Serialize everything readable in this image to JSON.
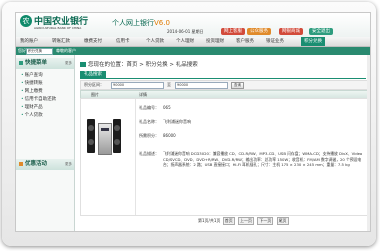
{
  "header": {
    "logo_glyph": "农",
    "bank_name": "中国农业银行",
    "bank_name_en": "AGRICULTURAL BANK OF CHINA",
    "product_name": "个人网上银行",
    "product_version": "V6.0",
    "date": "2014-06-01 星期日",
    "buttons": [
      {
        "label": "网上客服",
        "color": "#d24a3a"
      },
      {
        "label": "公众服务",
        "color": "#e08a2a"
      },
      {
        "label": "网银商城",
        "color": "#d24a3a"
      },
      {
        "label": "安全退出",
        "color": "#2d9c7e"
      }
    ]
  },
  "nav": {
    "items": [
      "我的账户",
      "转账汇款",
      "缴费支付",
      "信用卡",
      "个人贷款",
      "个人理财",
      "投资理财",
      "客户服务",
      "银证业务",
      "积分兑换"
    ],
    "active": "积分兑换"
  },
  "userbar": {
    "prefix": "您好",
    "account_select": "积分兑换",
    "suffix": "尊敬的客户"
  },
  "sidebar": {
    "quick_title": "快捷菜单",
    "quick_more": "更多",
    "quick_items": [
      "账户查询",
      "快捷转账",
      "网上缴费",
      "信用卡自助还款",
      "理财产品",
      "个人贷款"
    ],
    "promo_title": "优惠活动",
    "promo_more": "更多"
  },
  "main": {
    "breadcrumb": "您现在的位置：首页 > 积分兑换 > 礼品搜索",
    "tab_label": "礼品搜索",
    "filter": {
      "label": "积分区间：",
      "from_value": "90000",
      "to_label": "至",
      "to_value": "90000",
      "button": "查询"
    },
    "table_headers": [
      "图片",
      "详情"
    ],
    "product": {
      "rows": [
        {
          "label": "礼品编号：",
          "value": "065"
        },
        {
          "label": "礼品名称：",
          "value": "飞利浦迷你音响"
        },
        {
          "label": "所需积分：",
          "value": "86000"
        }
      ],
      "desc_label": "礼品描述：",
      "description": "飞利浦迷你音响 DCD3020：兼容播放 CD、CD-R/RW、MP3-CD、USB 闪存盘；WMA-CD；支持播放 DivX、Video CD/SVCD、DVD、DVD+R/RW、DVD-R/RW；输出功率：总功率 150W；收音机：FM/AM 数字调谐，20 个预设电台；扬声器系统：2 路；USB 直接接口；Hi-Fi 耳机插孔；尺寸：主机 175 × 230 × 245 mm；重量：7.5 kg"
    },
    "pager": {
      "text": "第1页/共1页",
      "buttons": [
        "首页",
        "上一页",
        "下一页",
        "尾页"
      ]
    }
  }
}
